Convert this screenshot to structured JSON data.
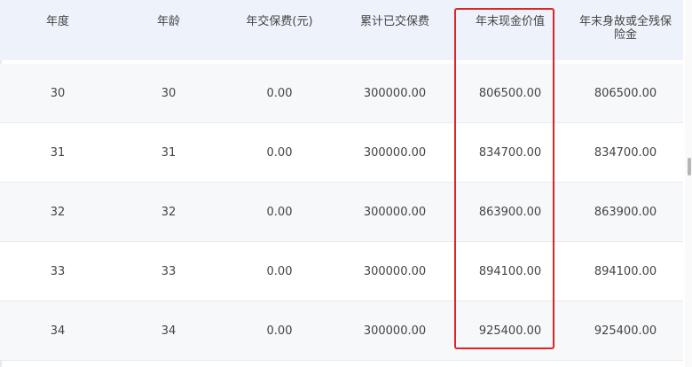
{
  "table": {
    "headers": [
      "年度",
      "年龄",
      "年交保费(元)",
      "累计已交保费",
      "年末现金价值",
      "年末身故或全残保险金"
    ],
    "rows": [
      [
        "30",
        "30",
        "0.00",
        "300000.00",
        "806500.00",
        "806500.00"
      ],
      [
        "31",
        "31",
        "0.00",
        "300000.00",
        "834700.00",
        "834700.00"
      ],
      [
        "32",
        "32",
        "0.00",
        "300000.00",
        "863900.00",
        "863900.00"
      ],
      [
        "33",
        "33",
        "0.00",
        "300000.00",
        "894100.00",
        "894100.00"
      ],
      [
        "34",
        "34",
        "0.00",
        "300000.00",
        "925400.00",
        "925400.00"
      ]
    ]
  },
  "colors": {
    "header_bg": "#eef3fb",
    "alt_row_bg": "#f7f8fa",
    "highlight": "#e02424"
  }
}
